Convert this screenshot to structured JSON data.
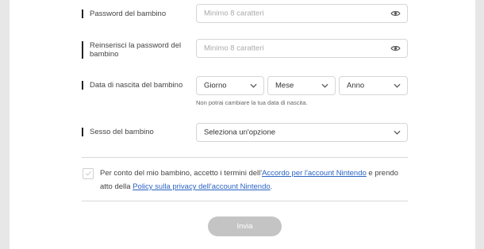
{
  "form": {
    "password": {
      "label": "Password del bambino",
      "placeholder": "Minimo 8 caratteri"
    },
    "password_confirm": {
      "label": "Reinserisci la password del bambino",
      "placeholder": "Minimo 8 caratteri"
    },
    "birthdate": {
      "label": "Data di nascita del bambino",
      "day": "Giorno",
      "month": "Mese",
      "year": "Anno",
      "hint": "Non potrai cambiare la tua data di nascita."
    },
    "gender": {
      "label": "Sesso del bambino",
      "value": "Seleziona un'opzione"
    },
    "terms": {
      "text_1": "Per conto del mio bambino, accetto i termini dell'",
      "link_1": "Accordo per l'account Nintendo",
      "text_2": " e prendo atto della ",
      "link_2": "Policy sulla privacy dell'account Nintendo",
      "text_3": "."
    },
    "submit_label": "Invia"
  },
  "icons": {
    "password_toggle": "eye-icon",
    "dropdown": "chevron-down-icon",
    "checkbox": "check-icon"
  },
  "colors": {
    "link": "#2b64c4",
    "button_disabled": "#c4c4c4",
    "background": "#e7e7e7"
  }
}
